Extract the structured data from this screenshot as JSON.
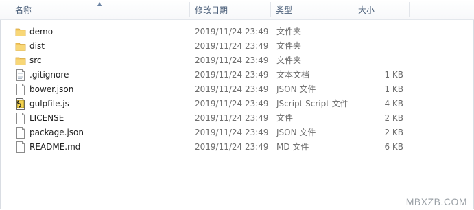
{
  "columns": {
    "name": "名称",
    "date": "修改日期",
    "type": "类型",
    "size": "大小"
  },
  "files": [
    {
      "name": "demo",
      "date": "2019/11/24 23:49",
      "type": "文件夹",
      "size": "",
      "icon": "folder-icon"
    },
    {
      "name": "dist",
      "date": "2019/11/24 23:49",
      "type": "文件夹",
      "size": "",
      "icon": "folder-icon"
    },
    {
      "name": "src",
      "date": "2019/11/24 23:49",
      "type": "文件夹",
      "size": "",
      "icon": "folder-icon"
    },
    {
      "name": ".gitignore",
      "date": "2019/11/24 23:49",
      "type": "文本文档",
      "size": "1 KB",
      "icon": "text-file-icon"
    },
    {
      "name": "bower.json",
      "date": "2019/11/24 23:49",
      "type": "JSON 文件",
      "size": "1 KB",
      "icon": "file-icon"
    },
    {
      "name": "gulpfile.js",
      "date": "2019/11/24 23:49",
      "type": "JScript Script 文件",
      "size": "4 KB",
      "icon": "script-file-icon"
    },
    {
      "name": "LICENSE",
      "date": "2019/11/24 23:49",
      "type": "文件",
      "size": "2 KB",
      "icon": "file-icon"
    },
    {
      "name": "package.json",
      "date": "2019/11/24 23:49",
      "type": "JSON 文件",
      "size": "2 KB",
      "icon": "file-icon"
    },
    {
      "name": "README.md",
      "date": "2019/11/24 23:49",
      "type": "MD 文件",
      "size": "6 KB",
      "icon": "file-icon"
    }
  ],
  "watermark": "MBXZB.COM",
  "colors": {
    "header_text": "#4c607a",
    "folder": "#f2c55c",
    "secondary_text": "#6d6d6d"
  }
}
